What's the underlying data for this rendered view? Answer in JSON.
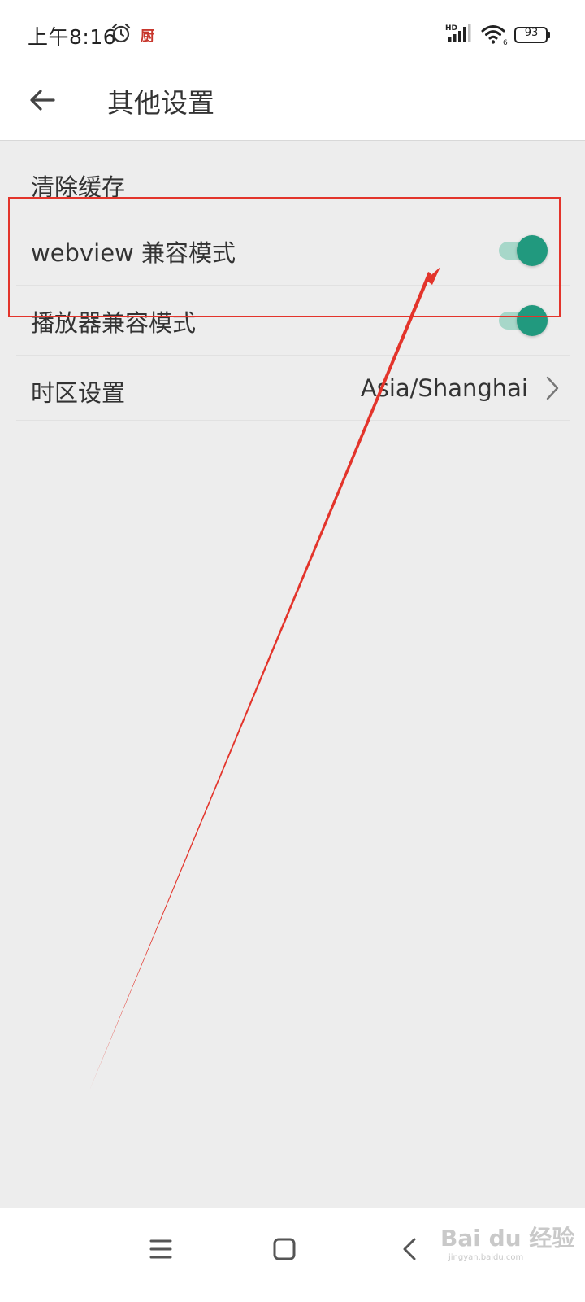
{
  "status_bar": {
    "time": "上午8:16",
    "app_notification": "厨",
    "network_label": "HD",
    "wifi_label": "6",
    "battery_level": "93"
  },
  "header": {
    "title": "其他设置"
  },
  "settings": {
    "clear_cache": {
      "label": "清除缓存"
    },
    "webview_compat": {
      "label": "webview 兼容模式",
      "enabled": true
    },
    "player_compat": {
      "label": "播放器兼容模式",
      "enabled": true
    },
    "timezone": {
      "label": "时区设置",
      "value": "Asia/Shanghai"
    }
  },
  "watermark": {
    "brand": "Bai du 经验",
    "site": "jingyan.baidu.com"
  },
  "colors": {
    "toggle_on": "#21997e",
    "toggle_track": "#a7d7c9",
    "annotation": "#e3342b",
    "background": "#ededed"
  }
}
